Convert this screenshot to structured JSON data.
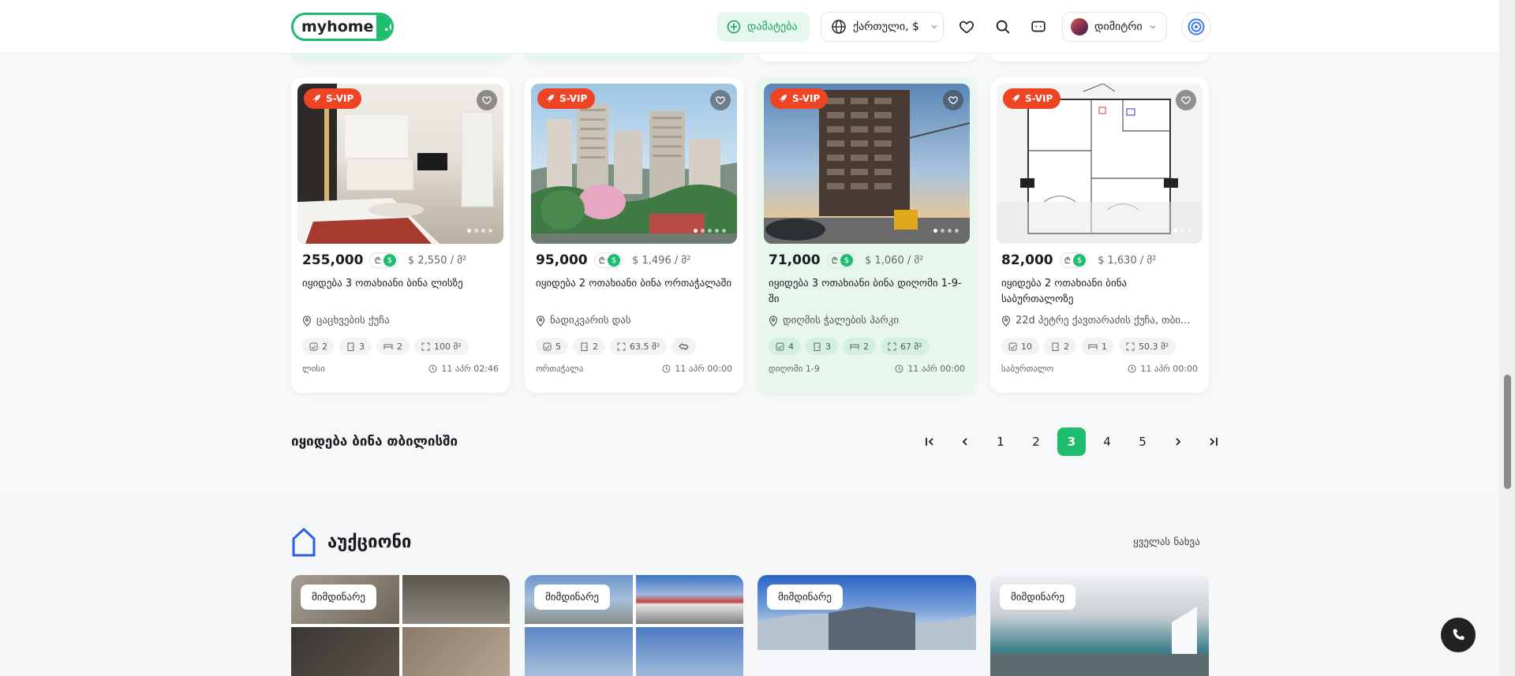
{
  "header": {
    "logo_main": "myhome",
    "logo_domain": ".ge",
    "add_label": "დამატება",
    "lang_label": "ქართული, $",
    "user_name": "დიმიტრი"
  },
  "listings": [
    {
      "badge": "S-VIP",
      "price": "255,000",
      "currency_gel": "₾",
      "currency_usd": "$",
      "price_per_sqm": "$  2,550 / მ²",
      "title": "იყიდება 3 ოთახიანი ბინა ლისზე",
      "location": "ცაცხვების ქუჩა",
      "specs": [
        "2",
        "3",
        "2",
        "100 მ²"
      ],
      "district": "ლისი",
      "date": "11 აპრ 02:46"
    },
    {
      "badge": "S-VIP",
      "price": "95,000",
      "currency_gel": "₾",
      "currency_usd": "$",
      "price_per_sqm": "$  1,496 / მ²",
      "title": "იყიდება 2 ოთახიანი ბინა ორთაჭალაში",
      "location": "ნადიკვარის დას",
      "specs": [
        "5",
        "2",
        "63.5 მ²"
      ],
      "district": "ორთაჭალა",
      "date": "11 აპრ 00:00"
    },
    {
      "badge": "S-VIP",
      "price": "71,000",
      "currency_gel": "₾",
      "currency_usd": "$",
      "price_per_sqm": "$  1,060 / მ²",
      "title": "იყიდება 3 ოთახიანი ბინა დიღომი 1-9-ში",
      "location": "დიღმის ჭალების პარკი",
      "specs": [
        "4",
        "3",
        "2",
        "67 მ²"
      ],
      "district": "დიღომი 1-9",
      "date": "11 აპრ 00:00"
    },
    {
      "badge": "S-VIP",
      "price": "82,000",
      "currency_gel": "₾",
      "currency_usd": "$",
      "price_per_sqm": "$  1,630 / მ²",
      "title": "იყიდება 2 ოთახიანი ბინა საბურთალოზე",
      "location": "22d პეტრე ქავთარაძის ქუჩა, თბი...",
      "specs": [
        "10",
        "2",
        "1",
        "50.3 მ²"
      ],
      "district": "საბურთალო",
      "date": "11 აპრ 00:00"
    }
  ],
  "pagination": {
    "caption": "იყიდება ბინა თბილისში",
    "pages": [
      "1",
      "2",
      "3",
      "4",
      "5"
    ],
    "current": "3"
  },
  "auction": {
    "title": "აუქციონი",
    "see_all": "ყველას ნახვა",
    "tag": "მიმდინარე"
  },
  "colors": {
    "brand_green": "#1ebd6d",
    "svip_red": "#ee4423"
  }
}
